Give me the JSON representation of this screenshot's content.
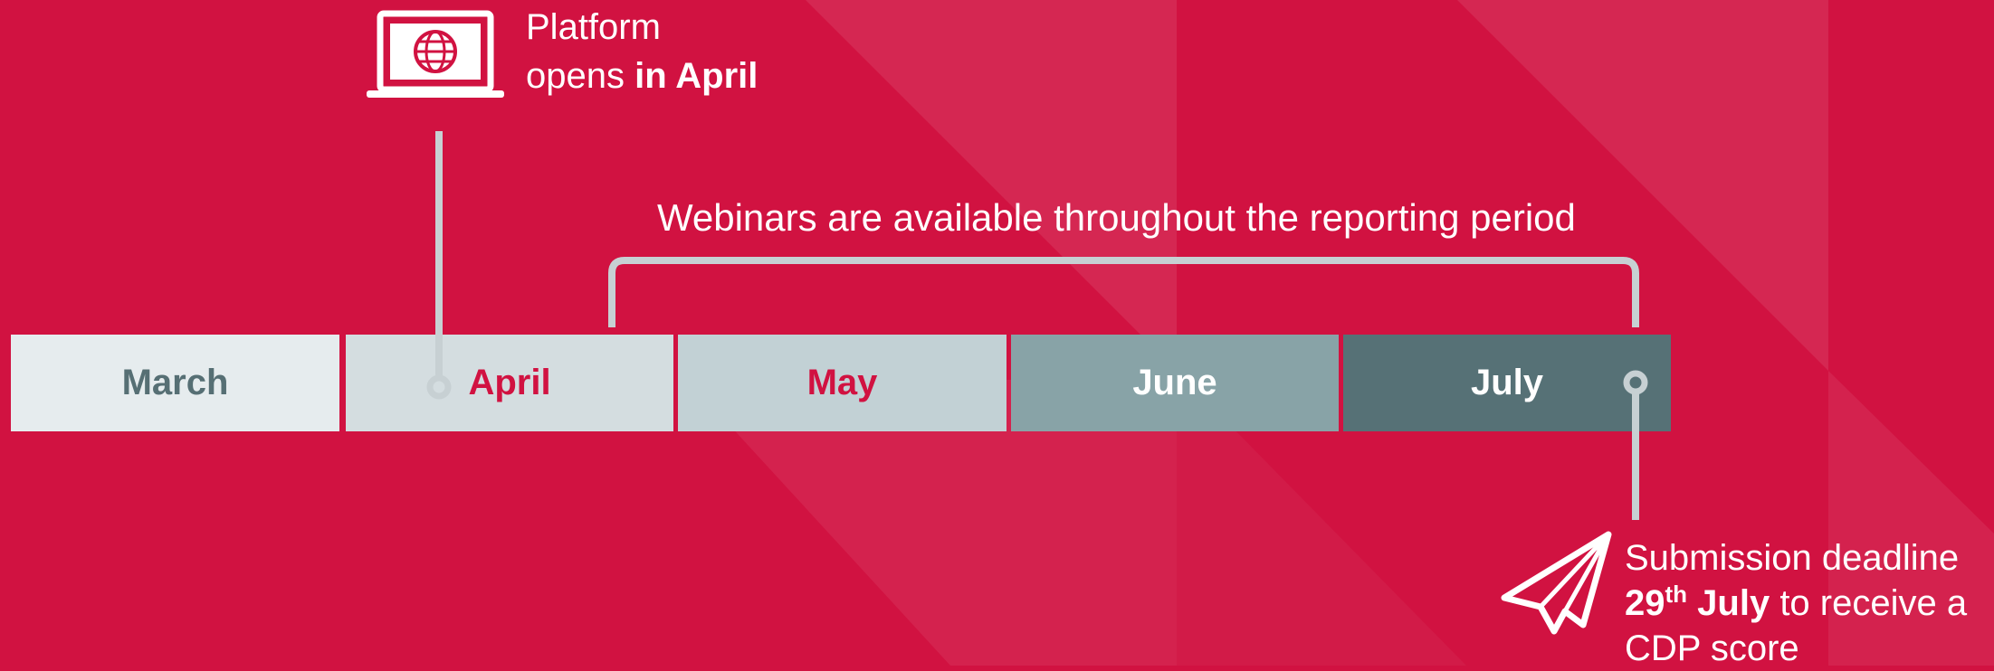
{
  "colors": {
    "background": "#d11241",
    "accent_red": "#d11241",
    "connector_gray": "#c7d0d3"
  },
  "timeline": {
    "months": [
      {
        "label": "March",
        "bg": "#e6ecee",
        "color": "#566f74"
      },
      {
        "label": "April",
        "bg": "#d4dde0",
        "color": "#d11241"
      },
      {
        "label": "May",
        "bg": "#c2d1d5",
        "color": "#d11241"
      },
      {
        "label": "June",
        "bg": "#88a3a7",
        "color": "#ffffff"
      },
      {
        "label": "July",
        "bg": "#567176",
        "color": "#ffffff"
      }
    ]
  },
  "platform_callout": {
    "icon": "laptop-globe-icon",
    "line1": "Platform",
    "line2_prefix": "opens ",
    "line2_bold": "in April"
  },
  "webinar_callout": {
    "text": "Webinars are available throughout the reporting period"
  },
  "deadline_callout": {
    "icon": "paper-plane-icon",
    "line1": "Submission deadline",
    "date_day": "29",
    "date_suffix": "th",
    "date_month": " July",
    "line2_rest": " to receive a",
    "line3": "CDP score"
  }
}
